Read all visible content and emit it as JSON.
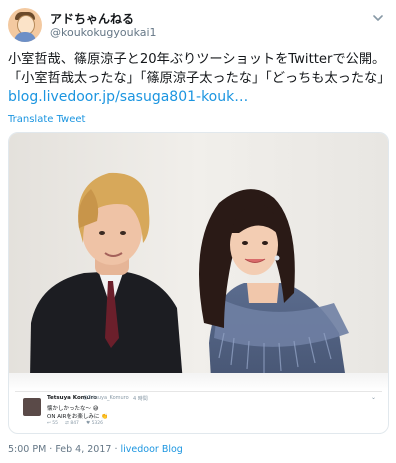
{
  "author": {
    "name": "アドちゃんねる",
    "handle": "@koukokugyoukai1"
  },
  "tweet": {
    "line1": "小室哲哉、篠原涼子と20年ぶりツーショットをTwitterで公開。",
    "line2": "「小室哲哉太ったな」「篠原涼子太ったな」「どっちも太ったな」",
    "link": "blog.livedoor.jp/sasuga801-kouk…",
    "translate": "Translate Tweet"
  },
  "embedded": {
    "name": "Tetsuya Komuro",
    "handle": "@Tetsuya_Komuro",
    "time": "4 時間",
    "line1": "懐かしかったな〜",
    "line2": "ON AIRをお楽しみに",
    "actions": {
      "replies": "55",
      "retweets": "847",
      "likes": "5326"
    }
  },
  "meta": {
    "time": "5:00 PM",
    "date": "Feb 4, 2017",
    "source": "livedoor Blog"
  },
  "colors": {
    "link": "#1b95e0",
    "text": "#14171a",
    "muted": "#657786",
    "border": "#e1e8ed"
  }
}
